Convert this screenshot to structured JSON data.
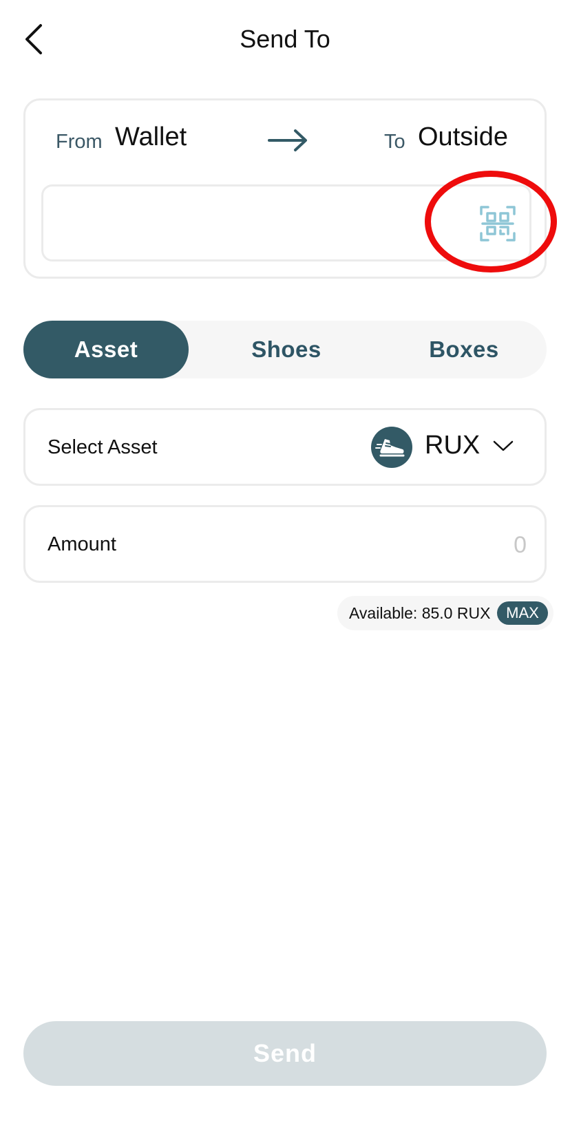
{
  "header": {
    "title": "Send To"
  },
  "transfer": {
    "from_label": "From",
    "from_value": "Wallet",
    "to_label": "To",
    "to_value": "Outside",
    "address_value": ""
  },
  "tabs": [
    {
      "label": "Asset",
      "active": true
    },
    {
      "label": "Shoes",
      "active": false
    },
    {
      "label": "Boxes",
      "active": false
    }
  ],
  "asset_select": {
    "label": "Select Asset",
    "selected_symbol": "RUX",
    "icon": "sneaker-icon"
  },
  "amount": {
    "label": "Amount",
    "placeholder": "0"
  },
  "available": {
    "text": "Available: 85.0 RUX",
    "max_label": "MAX"
  },
  "send_button": {
    "label": "Send",
    "enabled": false
  },
  "colors": {
    "accent": "#335a66",
    "qr_icon": "#8ec6d6",
    "highlight_ring": "#ee0c0c",
    "disabled_button": "#d5dde0",
    "border": "#ebebeb"
  }
}
